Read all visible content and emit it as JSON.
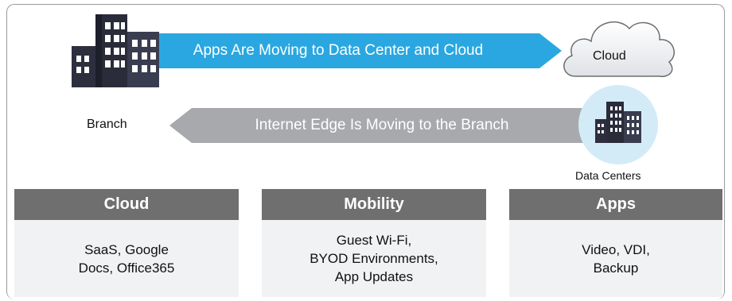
{
  "top_arrow": {
    "label": "Apps Are Moving to Data Center and Cloud",
    "color": "#2aa7e0"
  },
  "bottom_arrow": {
    "label": "Internet Edge Is Moving to the Branch",
    "color": "#a7a9ac"
  },
  "branch": {
    "label": "Branch",
    "icon": "building-icon"
  },
  "cloud": {
    "label": "Cloud",
    "icon": "cloud-icon"
  },
  "data_centers": {
    "label": "Data Centers",
    "icon": "building-icon"
  },
  "cards": [
    {
      "title": "Cloud",
      "lines": [
        "SaaS, Google",
        "Docs, Office365"
      ]
    },
    {
      "title": "Mobility",
      "lines": [
        "Guest Wi-Fi,",
        "BYOD Environments,",
        "App Updates"
      ]
    },
    {
      "title": "Apps",
      "lines": [
        "Video, VDI,",
        "Backup"
      ]
    }
  ]
}
